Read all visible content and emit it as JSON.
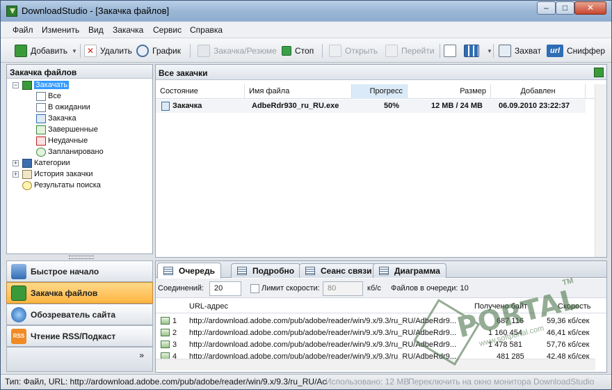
{
  "window": {
    "title": "DownloadStudio - [Закачка файлов]",
    "min_glyph": "–",
    "max_glyph": "□",
    "close_glyph": "✕"
  },
  "menu": [
    "Файл",
    "Изменить",
    "Вид",
    "Закачка",
    "Сервис",
    "Справка"
  ],
  "toolbar": {
    "add": "Добавить",
    "delete": "Удалить",
    "schedule": "График",
    "download_resume": "Закачка/Резюме",
    "stop": "Стоп",
    "open": "Открыть",
    "goto": "Перейти",
    "capture": "Захват",
    "sniffer": "Сниффер",
    "url_badge": "url",
    "dropdown_glyph": "▼"
  },
  "left_panel": {
    "title": "Закачка файлов",
    "tree": [
      {
        "label": "Закачать",
        "level": 0,
        "expanded": true,
        "selected": true,
        "expander": "−"
      },
      {
        "label": "Все",
        "level": 1
      },
      {
        "label": "В ожидании",
        "level": 1
      },
      {
        "label": "Закачка",
        "level": 1
      },
      {
        "label": "Завершенные",
        "level": 1
      },
      {
        "label": "Неудачные",
        "level": 1
      },
      {
        "label": "Запланировано",
        "level": 1
      },
      {
        "label": "Категории",
        "level": 0,
        "expander": "+"
      },
      {
        "label": "История закачки",
        "level": 0,
        "expander": "+"
      },
      {
        "label": "Результаты поиска",
        "level": 0
      }
    ],
    "nav": [
      {
        "label": "Быстрое начало"
      },
      {
        "label": "Закачка файлов",
        "active": true
      },
      {
        "label": "Обозреватель сайта"
      },
      {
        "label": "Чтение RSS/Подкаст",
        "badge": "RSS"
      }
    ],
    "more_glyph": "»"
  },
  "main_panel": {
    "title": "Все закачки",
    "columns": [
      "Состояние",
      "Имя файла",
      "Прогресс",
      "Размер",
      "Добавлен"
    ],
    "rows": [
      {
        "state": "Закачка",
        "filename": "AdbeRdr930_ru_RU.exe",
        "progress": "50%",
        "size": "12 MB / 24 MB",
        "added": "06.09.2010 23:22:37"
      }
    ]
  },
  "bottom_panel": {
    "tabs": [
      "Очередь",
      "Подробно",
      "Сеанс связи",
      "Диаграмма"
    ],
    "active_tab": 0,
    "connections_label": "Соединений:",
    "connections_value": "20",
    "speed_limit_label": "Лимит скорости:",
    "speed_limit_value": "80",
    "speed_unit": "кб/с",
    "queue_label": "Файлов в очереди: 10",
    "columns": [
      "URL-адрес",
      "Получено байт",
      "Скорость"
    ],
    "rows": [
      {
        "n": "1",
        "url": "http://ardownload.adobe.com/pub/adobe/reader/win/9.x/9.3/ru_RU/AdbeRdr9...",
        "bytes": "687 116",
        "speed": "59,36 кб/сек"
      },
      {
        "n": "2",
        "url": "http://ardownload.adobe.com/pub/adobe/reader/win/9.x/9.3/ru_RU/AdbeRdr9...",
        "bytes": "1 160 454",
        "speed": "46,41 кб/сек"
      },
      {
        "n": "3",
        "url": "http://ardownload.adobe.com/pub/adobe/reader/win/9.x/9.3/ru_RU/AdbeRdr9...",
        "bytes": "1 478 581",
        "speed": "57,76 кб/сек"
      },
      {
        "n": "4",
        "url": "http://ardownload.adobe.com/pub/adobe/reader/win/9.x/9.3/ru_RU/AdbeRdr9...",
        "bytes": "481 285",
        "speed": "42,48 кб/сек"
      }
    ]
  },
  "statusbar": {
    "left": "Тип: Файл, URL: http://ardownload.adobe.com/pub/adobe/reader/win/9.x/9.3/ru_RU/Ac",
    "used": "Использовано: 12 MB",
    "monitor": "Переключить на окно монитора DownloadStudio"
  },
  "watermark": {
    "big": "PORTAL",
    "small": "www.softportal.com",
    "tm": "TM"
  },
  "colors": {
    "accent": "#3399ff",
    "active_nav": "#ffb541",
    "titlebar": "#9bb7d6"
  }
}
